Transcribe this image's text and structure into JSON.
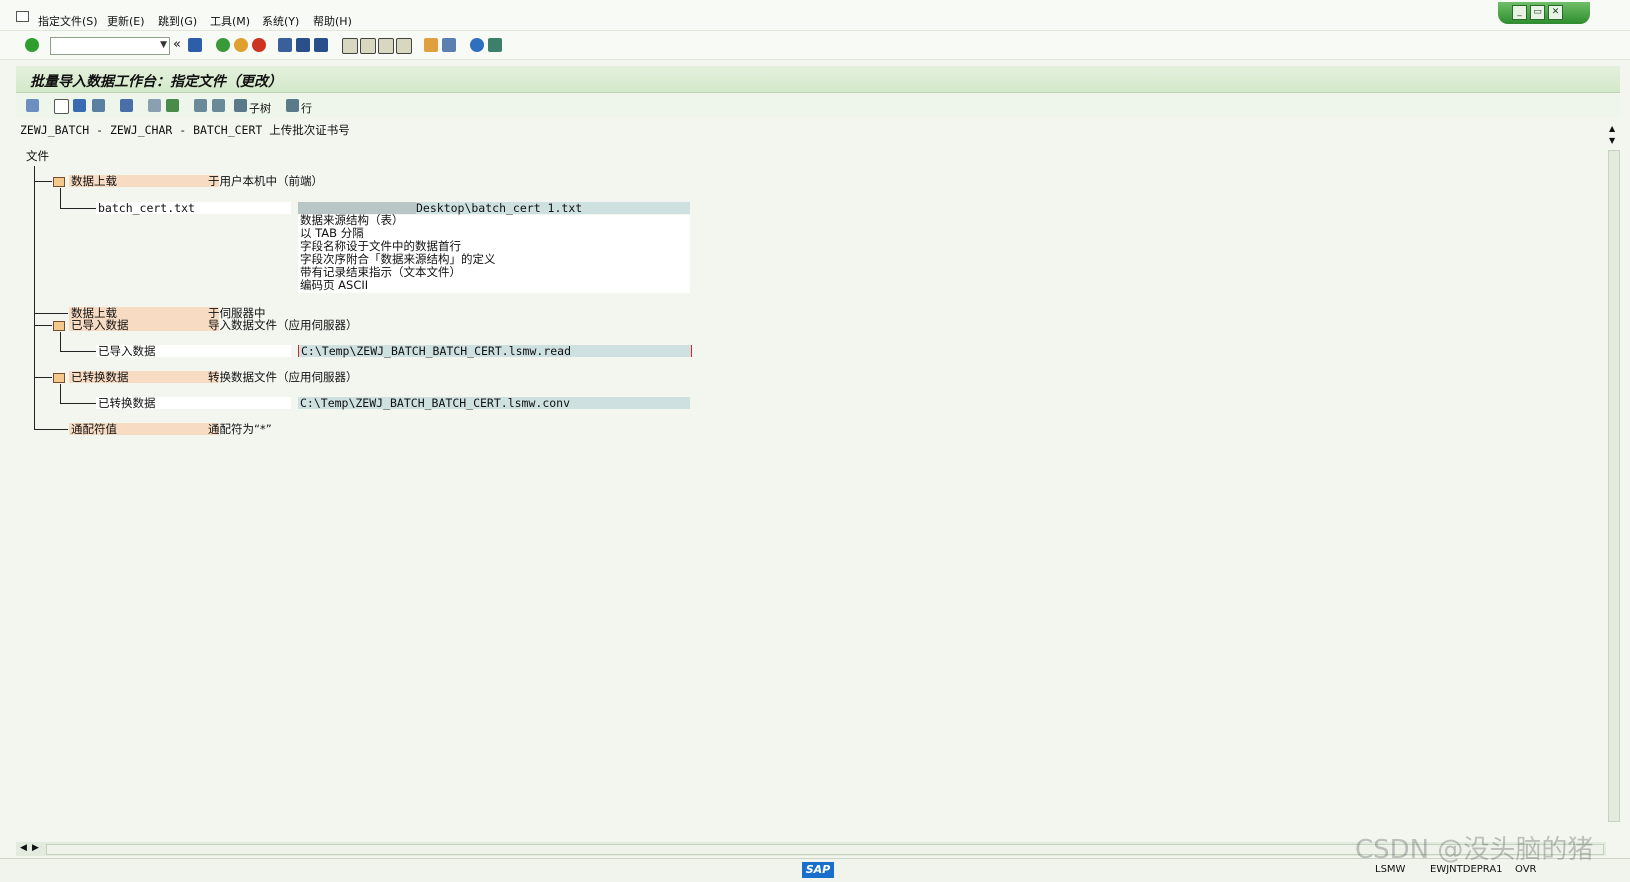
{
  "menu": {
    "items": [
      "指定文件(S)",
      "更新(E)",
      "跳到(G)",
      "工具(M)",
      "系统(Y)",
      "帮助(H)"
    ]
  },
  "title": "批量导入数据工作台：指定文件（更改）",
  "app_toolbar": {
    "subtree_label": "子树",
    "row_label": "行"
  },
  "header_line": "ZEWJ_BATCH - ZEWJ_CHAR - BATCH_CERT 上传批次证书号",
  "tree": {
    "root": "文件",
    "upload_client": {
      "label": "数据上载",
      "desc": "于用户本机中（前端）"
    },
    "batch_file": {
      "label": "batch_cert.txt",
      "path": "Desktop\\batch_cert 1.txt",
      "props": [
        "数据来源结构（表）",
        "以 TAB 分隔",
        "字段名称设于文件中的数据首行",
        "字段次序附合「数据来源结构」的定义",
        "带有记录结束指示（文本文件）",
        "编码页 ASCII"
      ]
    },
    "upload_server": {
      "label": "数据上载",
      "desc": "于伺服器中"
    },
    "imported": {
      "label": "已导入数据",
      "desc": "导入数据文件（应用伺服器）"
    },
    "imported_file": {
      "label": "已导入数据",
      "path": "C:\\Temp\\ZEWJ_BATCH_BATCH_CERT.lsmw.read"
    },
    "converted": {
      "label": "已转换数据",
      "desc": "转换数据文件（应用伺服器）"
    },
    "converted_file": {
      "label": "已转换数据",
      "path": "C:\\Temp\\ZEWJ_BATCH_BATCH_CERT.lsmw.conv"
    },
    "wildcard": {
      "label": "通配符值",
      "desc": "通配符为“*”"
    }
  },
  "status": {
    "sap": "SAP",
    "transaction": "LSMW",
    "server": "EWJNTDEPRA1",
    "mode": "OVR"
  },
  "watermark": "CSDN @没头脑的猪",
  "colors": {
    "title_band": "#d3e8c9",
    "highlight": "#f7dcc3",
    "field": "#cfe0e0"
  }
}
